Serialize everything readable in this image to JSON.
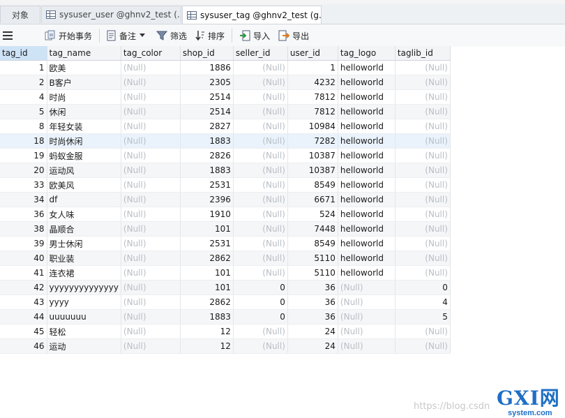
{
  "tabs": [
    {
      "label": "对象",
      "active": false,
      "icon": null
    },
    {
      "label": "sysuser_user @ghnv2_test (...",
      "active": false,
      "icon": "table-icon"
    },
    {
      "label": "sysuser_tag @ghnv2_test (g...",
      "active": true,
      "icon": "table-icon"
    }
  ],
  "toolbar": {
    "begin_transaction": "开始事务",
    "memo": "备注",
    "filter": "筛选",
    "sort": "排序",
    "import": "导入",
    "export": "导出"
  },
  "null_text": "(Null)",
  "columns": [
    "tag_id",
    "tag_name",
    "tag_color",
    "shop_id",
    "seller_id",
    "user_id",
    "tag_logo",
    "taglib_id"
  ],
  "rows": [
    [
      "1",
      "欧美",
      null,
      "1886",
      null,
      "1",
      "helloworld",
      null
    ],
    [
      "2",
      "B客户",
      null,
      "2305",
      null,
      "4232",
      "helloworld",
      null
    ],
    [
      "4",
      "时尚",
      null,
      "2514",
      null,
      "7812",
      "helloworld",
      null
    ],
    [
      "5",
      "休闲",
      null,
      "2514",
      null,
      "7812",
      "helloworld",
      null
    ],
    [
      "8",
      "年轻女装",
      null,
      "2827",
      null,
      "10984",
      "helloworld",
      null
    ],
    [
      "18",
      "时尚休闲",
      null,
      "1883",
      null,
      "7282",
      "helloworld",
      null
    ],
    [
      "19",
      "蚂蚁金服",
      null,
      "2826",
      null,
      "10387",
      "helloworld",
      null
    ],
    [
      "20",
      "运动风",
      null,
      "1883",
      null,
      "10387",
      "helloworld",
      null
    ],
    [
      "33",
      "欧美风",
      null,
      "2531",
      null,
      "8549",
      "helloworld",
      null
    ],
    [
      "34",
      "df",
      null,
      "2396",
      null,
      "6671",
      "helloworld",
      null
    ],
    [
      "36",
      "女人味",
      null,
      "1910",
      null,
      "524",
      "helloworld",
      null
    ],
    [
      "38",
      "晶顺合",
      null,
      "101",
      null,
      "7448",
      "helloworld",
      null
    ],
    [
      "39",
      "男士休闲",
      null,
      "2531",
      null,
      "8549",
      "helloworld",
      null
    ],
    [
      "40",
      "职业装",
      null,
      "2862",
      null,
      "5110",
      "helloworld",
      null
    ],
    [
      "41",
      "连衣裙",
      null,
      "101",
      null,
      "5110",
      "helloworld",
      null
    ],
    [
      "42",
      "yyyyyyyyyyyyyy",
      null,
      "101",
      "0",
      "36",
      null,
      "0"
    ],
    [
      "43",
      "yyyy",
      null,
      "2862",
      "0",
      "36",
      null,
      "4"
    ],
    [
      "44",
      "uuuuuuu",
      null,
      "1883",
      "0",
      "36",
      null,
      "5"
    ],
    [
      "45",
      "轻松",
      null,
      "12",
      null,
      "24",
      null,
      null
    ],
    [
      "46",
      "运动",
      null,
      "12",
      null,
      "24",
      null,
      null
    ]
  ],
  "watermark": {
    "url_text": "https://blog.csdn",
    "logo_text": "GXI网",
    "logo_sub": "system.com"
  },
  "colors": {
    "selected_header": "#cfe3f7",
    "null_text": "#b9bec4",
    "logo_blue": "#1f6fc4",
    "logo_red": "#d9342b"
  }
}
